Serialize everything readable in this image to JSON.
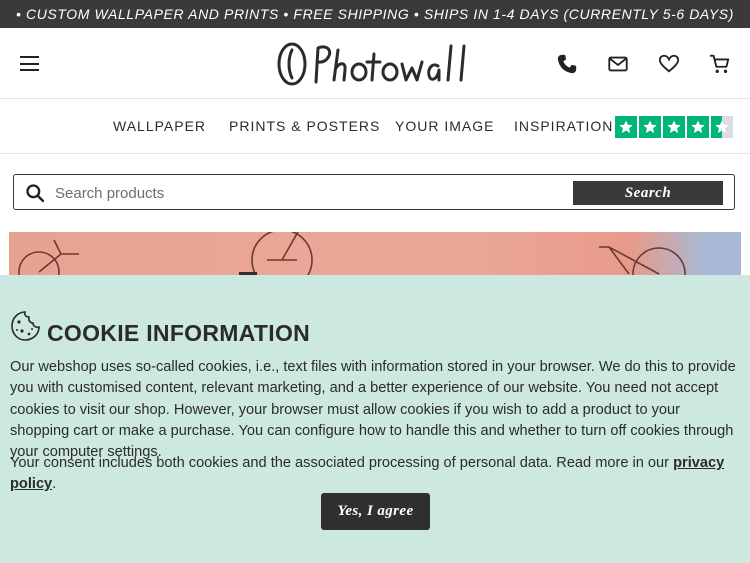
{
  "promo_bar": {
    "text": "• CUSTOM WALLPAPER AND PRINTS • FREE SHIPPING • SHIPS IN 1-4 DAYS (CURRENTLY 5-6 DAYS)"
  },
  "header": {
    "logo_text": "Photowall",
    "icons": [
      "menu-icon",
      "phone-icon",
      "mail-icon",
      "heart-icon",
      "cart-icon"
    ]
  },
  "nav": {
    "items": [
      {
        "label": "WALLPAPER"
      },
      {
        "label": "PRINTS & POSTERS"
      },
      {
        "label": "YOUR IMAGE"
      },
      {
        "label": "INSPIRATION"
      }
    ],
    "rating_stars": 4.5
  },
  "search": {
    "placeholder": "Search products",
    "value": "",
    "button_label": "Search"
  },
  "cookie": {
    "title": "COOKIE INFORMATION",
    "body": "Our webshop uses so-called cookies, i.e., text files with information stored in your browser. We do this to provide you with customised content, relevant marketing, and a better experience of our website. You need not accept cookies to visit our shop. However, your browser must allow cookies if you wish to add a product to your shopping cart or make a purchase. You can configure how to handle this and whether to turn off cookies through your computer settings.",
    "consent_text": "Your consent includes both cookies and the associated processing of personal data. Read more in our",
    "privacy_link": "privacy policy",
    "consent_end": ".",
    "agree_button": "Yes, I agree"
  },
  "colors": {
    "promo_bg": "#3a3a3a",
    "cookie_bg": "#cce8e0",
    "trustpilot_green": "#00b67a",
    "button_dark": "#2f2f2f",
    "hero_bg": "#eba898"
  }
}
